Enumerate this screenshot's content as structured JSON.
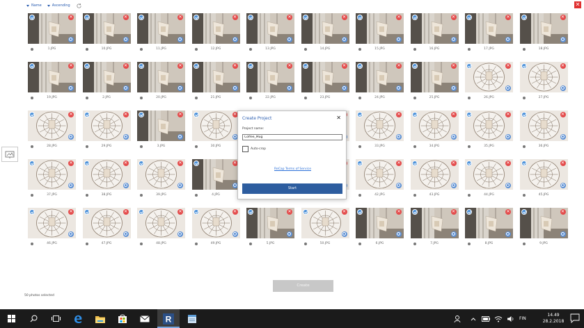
{
  "toolbar": {
    "sort_field": "Name",
    "sort_order": "Ascending"
  },
  "colors": {
    "accent": "#2a5db0",
    "start_button": "#2d5d9f",
    "remove_badge": "#e44b4b",
    "check_badge": "#4a90d9",
    "taskbar": "#1b1b1b"
  },
  "photos": [
    {
      "name": "1.JPG",
      "kind": "room"
    },
    {
      "name": "10.JPG",
      "kind": "room"
    },
    {
      "name": "11.JPG",
      "kind": "room"
    },
    {
      "name": "12.JPG",
      "kind": "room"
    },
    {
      "name": "13.JPG",
      "kind": "room"
    },
    {
      "name": "14.JPG",
      "kind": "room"
    },
    {
      "name": "15.JPG",
      "kind": "room"
    },
    {
      "name": "16.JPG",
      "kind": "room"
    },
    {
      "name": "17.JPG",
      "kind": "room"
    },
    {
      "name": "18.JPG",
      "kind": "room"
    },
    {
      "name": "19.JPG",
      "kind": "room"
    },
    {
      "name": "2.JPG",
      "kind": "room"
    },
    {
      "name": "20.JPG",
      "kind": "room"
    },
    {
      "name": "21.JPG",
      "kind": "room"
    },
    {
      "name": "22.JPG",
      "kind": "room"
    },
    {
      "name": "23.JPG",
      "kind": "room"
    },
    {
      "name": "24.JPG",
      "kind": "room"
    },
    {
      "name": "25.JPG",
      "kind": "room"
    },
    {
      "name": "26.JPG",
      "kind": "mug"
    },
    {
      "name": "27.JPG",
      "kind": "mug"
    },
    {
      "name": "28.JPG",
      "kind": "mug"
    },
    {
      "name": "29.JPG",
      "kind": "mug"
    },
    {
      "name": "3.JPG",
      "kind": "room"
    },
    {
      "name": "30.JPG",
      "kind": "mug"
    },
    {
      "name": "31.JPG",
      "kind": "mug"
    },
    {
      "name": "32.JPG",
      "kind": "mug"
    },
    {
      "name": "33.JPG",
      "kind": "mug"
    },
    {
      "name": "34.JPG",
      "kind": "mug"
    },
    {
      "name": "35.JPG",
      "kind": "mug"
    },
    {
      "name": "36.JPG",
      "kind": "mug"
    },
    {
      "name": "37.JPG",
      "kind": "mug"
    },
    {
      "name": "38.JPG",
      "kind": "mug"
    },
    {
      "name": "39.JPG",
      "kind": "mug"
    },
    {
      "name": "4.JPG",
      "kind": "room"
    },
    {
      "name": "40.JPG",
      "kind": "mug"
    },
    {
      "name": "41.JPG",
      "kind": "mug"
    },
    {
      "name": "42.JPG",
      "kind": "mug"
    },
    {
      "name": "43.JPG",
      "kind": "mug"
    },
    {
      "name": "44.JPG",
      "kind": "mug"
    },
    {
      "name": "45.JPG",
      "kind": "mug"
    },
    {
      "name": "46.JPG",
      "kind": "mug"
    },
    {
      "name": "47.JPG",
      "kind": "mug"
    },
    {
      "name": "48.JPG",
      "kind": "mug"
    },
    {
      "name": "49.JPG",
      "kind": "mug"
    },
    {
      "name": "5.JPG",
      "kind": "room"
    },
    {
      "name": "50.JPG",
      "kind": "mug"
    },
    {
      "name": "6.JPG",
      "kind": "room"
    },
    {
      "name": "7.JPG",
      "kind": "room"
    },
    {
      "name": "8.JPG",
      "kind": "room"
    },
    {
      "name": "9.JPG",
      "kind": "room"
    }
  ],
  "dialog": {
    "title": "Create Project",
    "name_label": "Project name:",
    "name_value": "Coffee_Mug",
    "autocrop_label": "Auto-crop",
    "autocrop_checked": false,
    "terms_link": "ReCap Terms of Service",
    "start_label": "Start"
  },
  "footer": {
    "create_label": "Create",
    "status": "50 photos selected"
  },
  "taskbar": {
    "apps": [
      "windows-start-icon",
      "search-icon",
      "task-view-icon",
      "edge-browser-icon",
      "file-explorer-icon",
      "store-icon",
      "mail-icon",
      "recap-app-icon",
      "notepad-icon"
    ],
    "active_app": "recap-app-icon",
    "language": "FIN",
    "time": "14.49",
    "date": "28.2.2018"
  }
}
